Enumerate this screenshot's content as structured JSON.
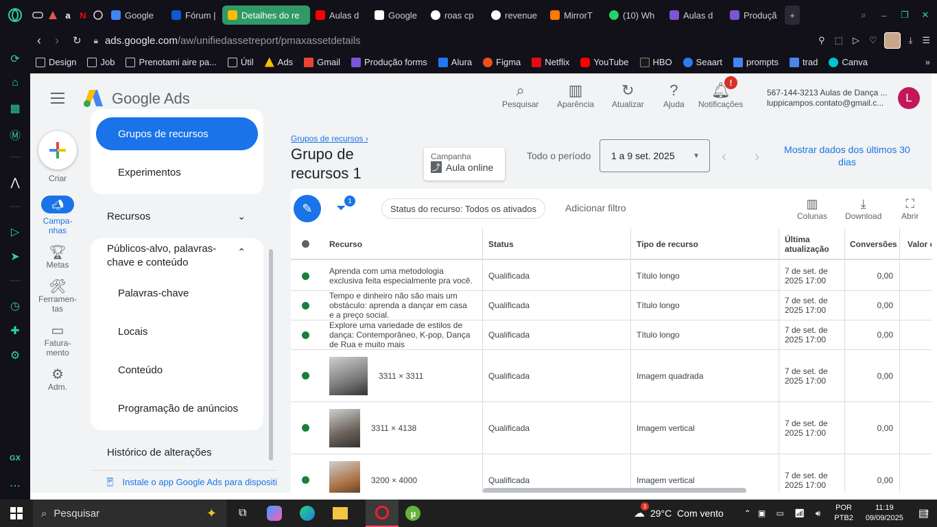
{
  "browser": {
    "tabs": [
      {
        "label": "Google",
        "color": "#4285f4"
      },
      {
        "label": "Fórum |",
        "color": "#0b5bd3"
      },
      {
        "label": "Detalhes do re",
        "color": "#fbbc04",
        "active": true
      },
      {
        "label": "Aulas d",
        "color": "#ff0000"
      },
      {
        "label": "Google",
        "color": "#ffffff"
      },
      {
        "label": "roas cp",
        "color": "#ffffff"
      },
      {
        "label": "revenue",
        "color": "#ffffff"
      },
      {
        "label": "MirrorT",
        "color": "#ff7a00"
      },
      {
        "label": "(10) Wh",
        "color": "#25d366"
      },
      {
        "label": "Aulas d",
        "color": "#7b55d6"
      },
      {
        "label": "Produçã",
        "color": "#7b55d6"
      }
    ],
    "url_prefix": "ads.google.com",
    "url_rest": "/aw/unifiedassetreport/pmaxassetdetails",
    "bookmarks": [
      "Design",
      "Job",
      "Prenotami aire pa...",
      "Útil",
      "Ads",
      "Gmail",
      "Produção forms",
      "Alura",
      "Figma",
      "Netflix",
      "YouTube",
      "HBO",
      "Seaart",
      "prompts",
      "trad",
      "Canva"
    ]
  },
  "header": {
    "brand": "Google Ads",
    "actions": [
      "Pesquisar",
      "Aparência",
      "Atualizar",
      "Ajuda",
      "Notificações"
    ],
    "notif_badge": "!",
    "account_line1": "567-144-3213 Aulas de Dança ...",
    "account_line2": "luppicampos.contato@gmail.c...",
    "avatar": "L"
  },
  "rail": {
    "create": "Criar",
    "items": [
      "Campa-\nnhas",
      "Metas",
      "Ferramen-\ntas",
      "Fatura-\nmento",
      "Adm."
    ]
  },
  "nav": {
    "active": "Grupos de recursos",
    "experiments": "Experimentos",
    "recursos": "Recursos",
    "publicos": "Públicos-alvo, palavras-chave e conteúdo",
    "sub": [
      "Palavras-chave",
      "Locais",
      "Conteúdo",
      "Programação de anúncios"
    ],
    "history": "Histórico de alterações",
    "install": "Instale o app Google Ads para dispositi"
  },
  "main": {
    "breadcrumb": "Grupos de recursos",
    "title": "Grupo de recursos 1",
    "campaign_label": "Campanha",
    "campaign_value": "Aula online",
    "period_label": "Todo o período",
    "date_range": "1 a 9 set. 2025",
    "show_last": "Mostrar dados dos últimos 30 dias",
    "filter_badge": "1",
    "filter_chip": "Status do recurso: Todos os ativados",
    "add_filter": "Adicionar filtro",
    "tools": [
      "Colunas",
      "Download",
      "Abrir"
    ]
  },
  "table": {
    "headers": [
      "Recurso",
      "Status",
      "Tipo de recurso",
      "Última atualização",
      "Conversões",
      "Valor c"
    ],
    "rows": [
      {
        "resource": "Aprenda com uma metodologia exclusiva feita especialmente pra você.",
        "status": "Qualificada",
        "type": "Título longo",
        "updated": "7 de set. de 2025 17:00",
        "conv": "0,00"
      },
      {
        "resource": "Tempo e dinheiro não são mais um obstáculo: aprenda a dançar em casa e a preço social.",
        "status": "Qualificada",
        "type": "Título longo",
        "updated": "7 de set. de 2025 17:00",
        "conv": "0,00"
      },
      {
        "resource": "Explore uma variedade de estilos de dança: Contemporâneo, K-pop, Dança de Rua e muito mais",
        "status": "Qualificada",
        "type": "Título longo",
        "updated": "7 de set. de 2025 17:00",
        "conv": "0,00"
      },
      {
        "resource": "3311 × 3311",
        "status": "Qualificada",
        "type": "Imagem quadrada",
        "updated": "7 de set. de 2025 17:00",
        "conv": "0,00"
      },
      {
        "resource": "3311 × 4138",
        "status": "Qualificada",
        "type": "Imagem vertical",
        "updated": "7 de set. de 2025 17:00",
        "conv": "0,00"
      },
      {
        "resource": "3200 × 4000",
        "status": "Qualificada",
        "type": "Imagem vertical",
        "updated": "7 de set. de 2025 17:00",
        "conv": "0,00"
      }
    ]
  },
  "taskbar": {
    "search": "Pesquisar",
    "weather": "29°C  Com vento",
    "lang1": "POR",
    "lang2": "PTB2",
    "time": "11:19",
    "date": "09/09/2025",
    "notif": "2",
    "weather_badge": "3"
  }
}
